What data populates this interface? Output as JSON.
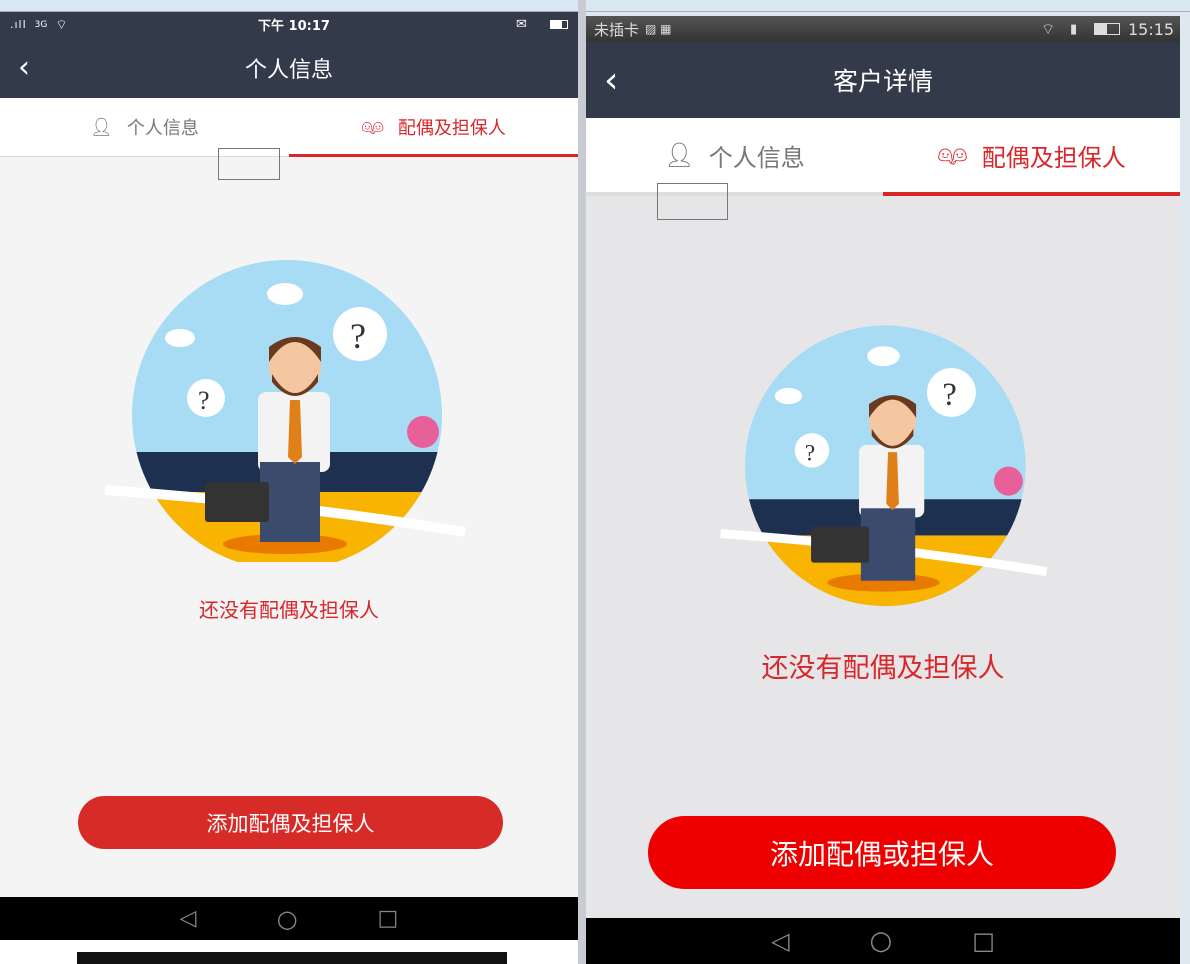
{
  "left_phone": {
    "status": {
      "time": "下午 10:17",
      "network": "3G"
    },
    "header": {
      "title": "个人信息"
    },
    "tabs": [
      {
        "label": "个人信息",
        "active": false
      },
      {
        "label": "配偶及担保人",
        "active": true
      }
    ],
    "empty_text": "还没有配偶及担保人",
    "add_button": "添加配偶及担保人",
    "colors": {
      "accent": "#d8262a",
      "button": "#d62b27"
    }
  },
  "right_phone": {
    "status": {
      "carrier": "未插卡",
      "time": "15:15"
    },
    "header": {
      "title": "客户详情"
    },
    "tabs": [
      {
        "label": "个人信息",
        "active": false
      },
      {
        "label": "配偶及担保人",
        "active": true
      }
    ],
    "empty_text": "还没有配偶及担保人",
    "add_button": "添加配偶或担保人",
    "colors": {
      "accent": "#d8262a",
      "button": "#ee0000"
    }
  }
}
